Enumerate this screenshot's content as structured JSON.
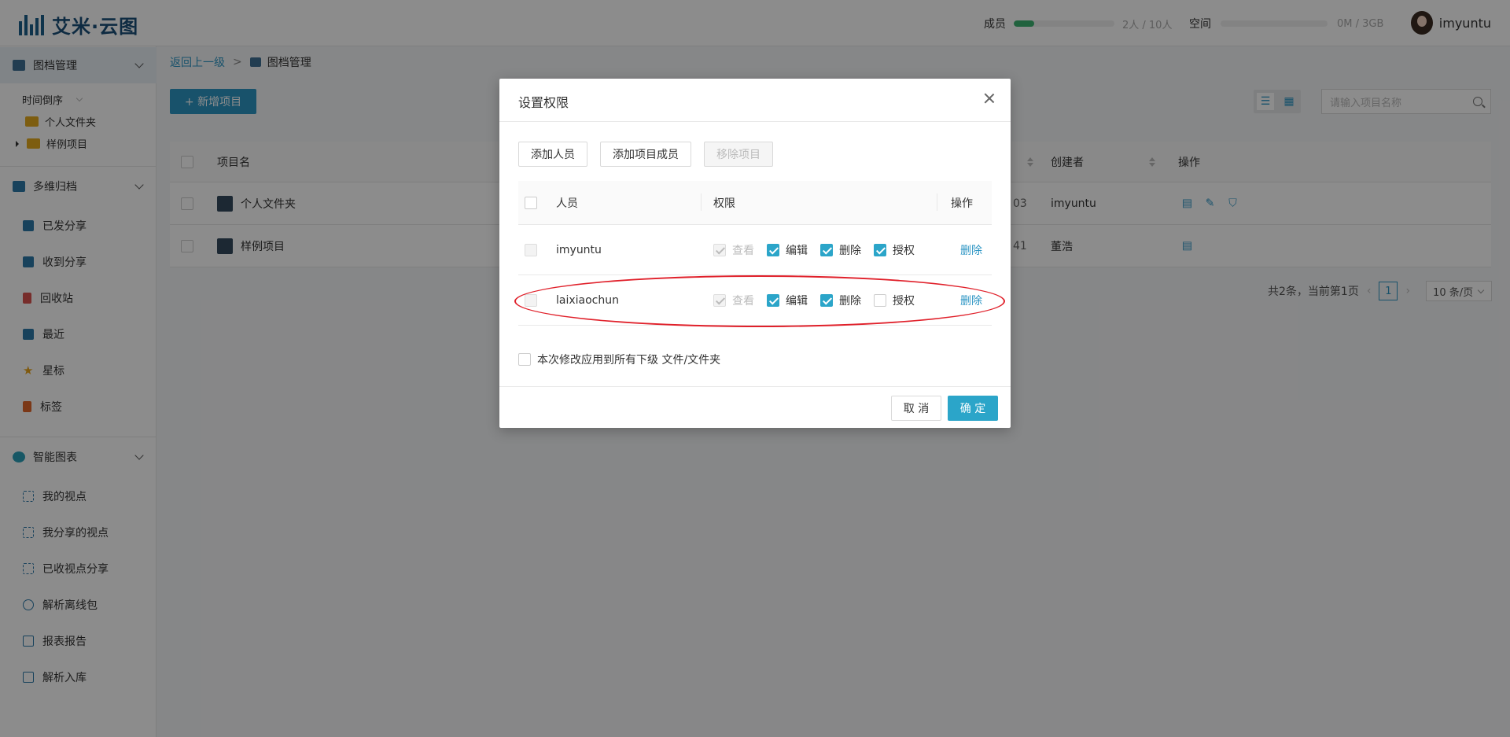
{
  "header": {
    "app_name": "艾米·云图",
    "members_label": "成员",
    "members_value": "2人 / 10人",
    "members_fraction": 0.2,
    "space_label": "空间",
    "space_value": "0M / 3GB",
    "space_fraction": 0.0,
    "username": "imyuntu",
    "accent_color": "#2c95c4"
  },
  "sidebar": {
    "groups": [
      {
        "label": "图档管理",
        "icon": "archive-icon"
      },
      {
        "label": "多维归档",
        "icon": "multi-archive-icon"
      },
      {
        "label": "智能图表",
        "icon": "smart-chart-icon"
      }
    ],
    "sort_label": "时间倒序",
    "tree": [
      "个人文件夹",
      "样例项目"
    ],
    "archive_items": [
      {
        "label": "已发分享",
        "icon": "sent-share-icon"
      },
      {
        "label": "收到分享",
        "icon": "received-share-icon"
      },
      {
        "label": "回收站",
        "icon": "trash-icon"
      },
      {
        "label": "最近",
        "icon": "recent-icon"
      },
      {
        "label": "星标",
        "icon": "star-icon"
      },
      {
        "label": "标签",
        "icon": "tag-icon"
      }
    ],
    "chart_items": [
      {
        "label": "我的视点",
        "icon": "viewpoint-icon"
      },
      {
        "label": "我分享的视点",
        "icon": "shared-viewpoint-icon"
      },
      {
        "label": "已收视点分享",
        "icon": "received-viewpoint-icon"
      },
      {
        "label": "解析离线包",
        "icon": "globe-icon"
      },
      {
        "label": "报表报告",
        "icon": "report-icon"
      },
      {
        "label": "解析入库",
        "icon": "import-icon"
      }
    ]
  },
  "main": {
    "back_link": "返回上一级",
    "breadcrumb_sep": ">",
    "current": "图档管理",
    "new_button": "+ 新增项目",
    "search_placeholder": "请输入项目名称",
    "columns": {
      "name": "项目名",
      "creator": "创建者",
      "ops": "操作"
    },
    "rows": [
      {
        "name": "个人文件夹",
        "date_tail": "03",
        "creator": "imyuntu"
      },
      {
        "name": "样例项目",
        "date_tail": "41",
        "creator": "董浩"
      }
    ],
    "pager_summary": "共2条，当前第1页",
    "pager_page": "1",
    "pager_size": "10 条/页"
  },
  "modal": {
    "title": "设置权限",
    "btn_add_person": "添加人员",
    "btn_add_member": "添加项目成员",
    "btn_remove": "移除项目",
    "col_person": "人员",
    "col_perm": "权限",
    "col_op": "操作",
    "perm_labels": {
      "view": "查看",
      "edit": "编辑",
      "delete": "删除",
      "grant": "授权"
    },
    "people": [
      {
        "name": "imyuntu",
        "view": true,
        "edit": true,
        "delete": true,
        "grant": true,
        "action": "删除"
      },
      {
        "name": "laixiaochun",
        "view": true,
        "edit": true,
        "delete": true,
        "grant": false,
        "action": "删除"
      }
    ],
    "apply_all": "本次修改应用到所有下级 文件/文件夹",
    "cancel": "取 消",
    "ok": "确 定"
  }
}
